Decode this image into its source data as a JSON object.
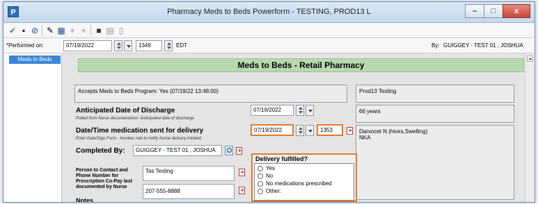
{
  "window": {
    "title": "Pharmacy Meds to Beds Powerform - TESTING, PROD13 L",
    "app_icon": "P",
    "buttons": {
      "minimize": "–",
      "maximize": "□",
      "close": "x"
    }
  },
  "toolbar": {
    "icons": [
      "check-icon",
      "save-icon",
      "cancel-icon",
      "tool-icon",
      "calendar-icon",
      "plus-icon",
      "plus-icon",
      "monitor-icon",
      "grid-icon",
      "document-icon"
    ]
  },
  "performed": {
    "label": "*Performed on:",
    "date": "07/19/2022",
    "time": "1349",
    "tz": "EDT",
    "by_label": "By:",
    "by_value": "GUIGGEY - TEST 01 , JOSHUA"
  },
  "sidebar": {
    "items": [
      {
        "label": "Meds to Beds"
      }
    ]
  },
  "form": {
    "header": "Meds to Beds - Retail Pharmacy",
    "accepts": "Accepts Meds to Beds Program: Yes (07/19/22 13:48:00)",
    "patient_name": "Prod13 Testing",
    "age": "66 years",
    "allergies_line1": "Darvocet N (hives,Swelling)",
    "allergies_line2": "NKA",
    "discharge": {
      "label": "Anticipated Date of Discharge",
      "sub": "Pulled from Nurse documentation: Anticipated date of discharge",
      "date": "07/19/2022"
    },
    "delivery_sent": {
      "label": "Date/Time medication sent for delivery",
      "sub": "Enter Date/Sign Form - Invokes rule to notify Nurse delivery initated.",
      "date": "07/19/2022",
      "time": "1353"
    },
    "completed_by": {
      "label": "Completed By:",
      "value": "GUIGGEY - TEST 01 , JOSHUA"
    },
    "contact": {
      "label_lines": [
        "Person to Contact and",
        "Phone Number for",
        "Prescription Co-Pay last",
        "documented by Nurse"
      ],
      "name": "Tas Testing",
      "phone": "207-555-8888"
    },
    "notes_label": "Notes",
    "delivery_fulfilled": {
      "label": "Delivery fulfilled?",
      "options": [
        "Yes",
        "No",
        "No medications prescribed",
        "Other:"
      ]
    }
  }
}
